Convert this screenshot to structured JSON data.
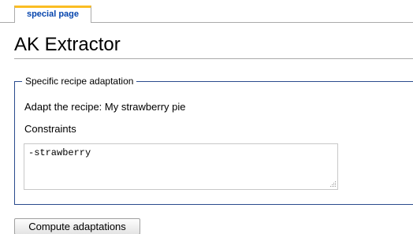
{
  "tabs": [
    {
      "label": "special page"
    }
  ],
  "page": {
    "title": "AK Extractor"
  },
  "form": {
    "legend": "Specific recipe adaptation",
    "adapt_prefix": "Adapt the recipe: ",
    "recipe_name": "My strawberry pie",
    "constraints_label": "Constraints",
    "constraints_value": "-strawberry",
    "submit_label": "Compute adaptations"
  },
  "colors": {
    "tab_accent": "#fabd23",
    "tab_link": "#0645ad",
    "fieldset_border": "#2a4b8d"
  }
}
